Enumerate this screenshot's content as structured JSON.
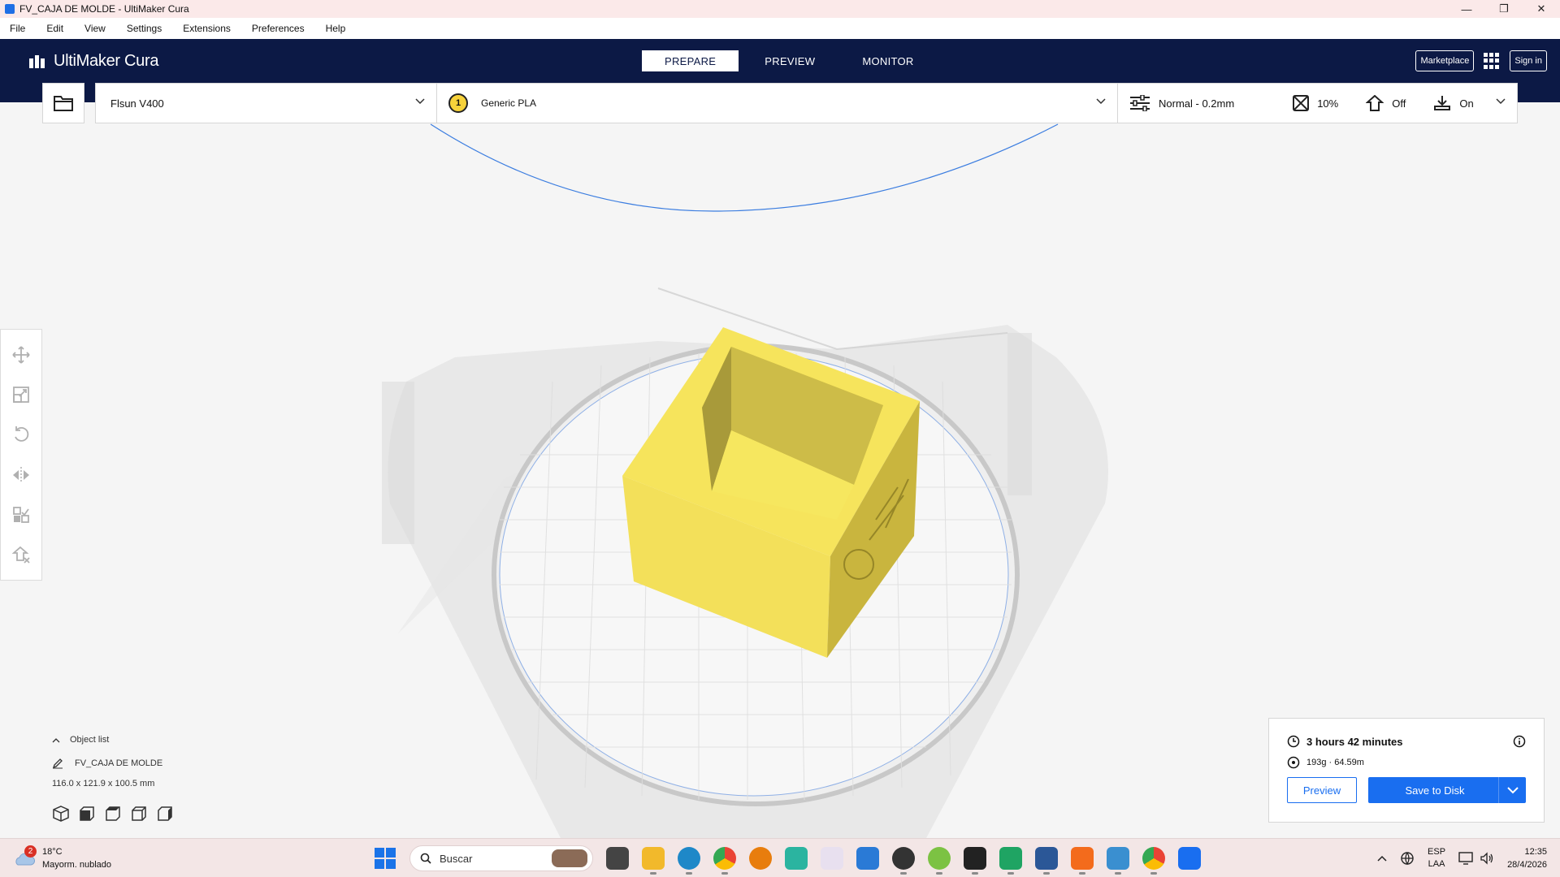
{
  "window": {
    "title": "FV_CAJA DE MOLDE - UltiMaker Cura",
    "controls": [
      "—",
      "❐",
      "✕"
    ]
  },
  "menu": [
    "File",
    "Edit",
    "View",
    "Settings",
    "Extensions",
    "Preferences",
    "Help"
  ],
  "header": {
    "logo": "UltiMaker Cura",
    "stages": [
      "PREPARE",
      "PREVIEW",
      "MONITOR"
    ],
    "active_stage": "PREPARE",
    "marketplace": "Marketplace",
    "sign_in": "Sign in"
  },
  "toolbar": {
    "printer": "Flsun V400",
    "extruder_number": "1",
    "material": "Generic PLA",
    "profile": "Normal - 0.2mm",
    "infill": "10%",
    "support": "Off",
    "adhesion": "On"
  },
  "tools": [
    "move-icon",
    "scale-icon",
    "rotate-icon",
    "mirror-icon",
    "per-model-settings-icon",
    "support-blocker-icon"
  ],
  "object_list": {
    "header": "Object list",
    "file": "FV_CAJA DE MOLDE",
    "dimensions": "116.0 x 121.9 x 100.5 mm"
  },
  "print_panel": {
    "time": "3 hours 42 minutes",
    "material": "193g · 64.59m",
    "preview_button": "Preview",
    "save_button": "Save to Disk"
  },
  "taskbar": {
    "weather_badge": "2",
    "temperature": "18°C",
    "condition": "Mayorm. nublado",
    "search_placeholder": "Buscar",
    "lang_top": "ESP",
    "lang_bottom": "LAA",
    "time": "12:35",
    "date": "28/4/2026"
  },
  "colors": {
    "header": "#0c1945",
    "accent": "#196ef0",
    "model": "#f5e05a"
  }
}
